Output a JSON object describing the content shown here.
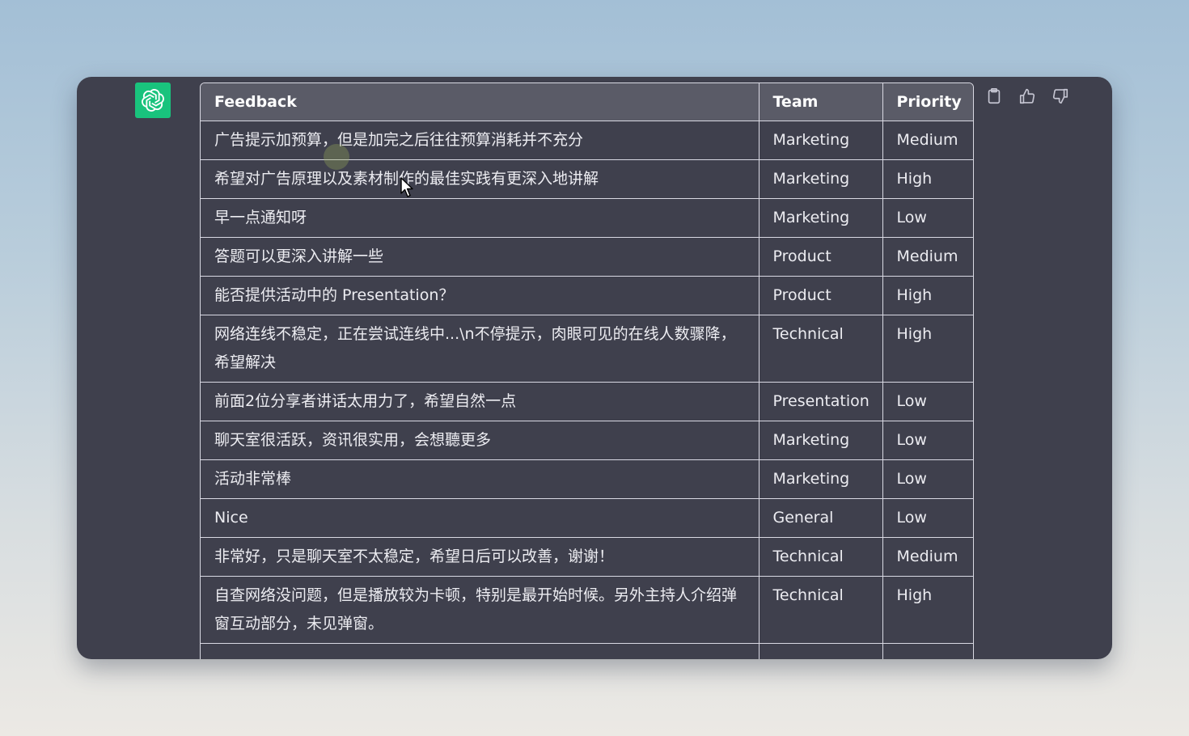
{
  "table": {
    "headers": [
      "Feedback",
      "Team",
      "Priority"
    ],
    "rows": [
      {
        "feedback": "广告提示加预算，但是加完之后往往预算消耗并不充分",
        "team": "Marketing",
        "priority": "Medium"
      },
      {
        "feedback": "希望对广告原理以及素材制作的最佳实践有更深入地讲解",
        "team": "Marketing",
        "priority": "High"
      },
      {
        "feedback": "早一点通知呀",
        "team": "Marketing",
        "priority": "Low"
      },
      {
        "feedback": "答题可以更深入讲解一些",
        "team": "Product",
        "priority": "Medium"
      },
      {
        "feedback": "能否提供活动中的 Presentation？",
        "team": "Product",
        "priority": "High"
      },
      {
        "feedback": "网络连线不稳定，正在尝试连线中...\\n不停提示，肉眼可见的在线人数骤降，希望解决",
        "team": "Technical",
        "priority": "High"
      },
      {
        "feedback": "前面2位分享者讲话太用力了，希望自然一点",
        "team": "Presentation",
        "priority": "Low"
      },
      {
        "feedback": "聊天室很活跃，资讯很实用，会想聽更多",
        "team": "Marketing",
        "priority": "Low"
      },
      {
        "feedback": "活动非常棒",
        "team": "Marketing",
        "priority": "Low"
      },
      {
        "feedback": "Nice",
        "team": "General",
        "priority": "Low"
      },
      {
        "feedback": "非常好，只是聊天室不太稳定，希望日后可以改善，谢谢！",
        "team": "Technical",
        "priority": "Medium"
      },
      {
        "feedback": "自查网络没问题，但是播放较为卡顿，特别是最开始时候。另外主持人介绍弹窗互动部分，未见弹窗。",
        "team": "Technical",
        "priority": "High"
      },
      {
        "feedback": "",
        "team": "",
        "priority": ""
      }
    ]
  },
  "toolbar": {
    "icons": [
      "clipboard-icon",
      "thumbs-up-icon",
      "thumbs-down-icon"
    ]
  },
  "colors": {
    "background": "#3f404d",
    "header_bg": "#5a5b67",
    "avatar": "#19c37d"
  }
}
